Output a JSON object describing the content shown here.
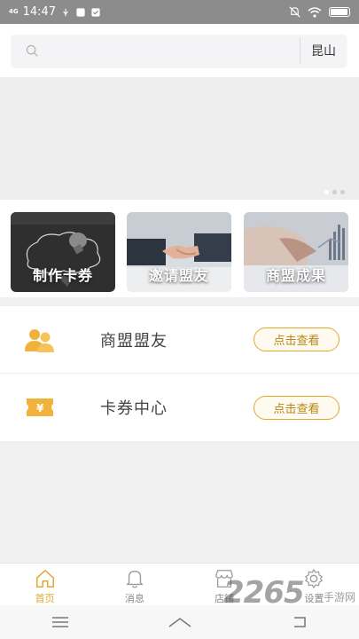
{
  "status_bar": {
    "network": "4G",
    "time": "14:47",
    "accent": "#8c8c8c"
  },
  "search": {
    "placeholder": "",
    "city": "昆山"
  },
  "banner": {
    "page_count": 3,
    "active_index": 0
  },
  "cards": [
    {
      "label": "制作卡券",
      "icon": "chalkboard-bulb-image"
    },
    {
      "label": "邀请盟友",
      "icon": "handshake-image"
    },
    {
      "label": "商盟成果",
      "icon": "business-chart-image"
    }
  ],
  "list": [
    {
      "label": "商盟盟友",
      "button": "点击查看",
      "icon": "users-icon"
    },
    {
      "label": "卡券中心",
      "button": "点击查看",
      "icon": "yuan-ticket-icon"
    }
  ],
  "tabbar": [
    {
      "label": "首页",
      "icon": "home-icon",
      "active": true
    },
    {
      "label": "消息",
      "icon": "bell-icon",
      "active": false
    },
    {
      "label": "店铺",
      "icon": "store-icon",
      "active": false
    },
    {
      "label": "设置",
      "icon": "gear-icon",
      "active": false
    }
  ],
  "watermark": {
    "text": "2265",
    "sub": "手游网"
  },
  "colors": {
    "accent": "#e0a92e",
    "accent_text": "#b8861a",
    "background": "#f0f0f0"
  }
}
